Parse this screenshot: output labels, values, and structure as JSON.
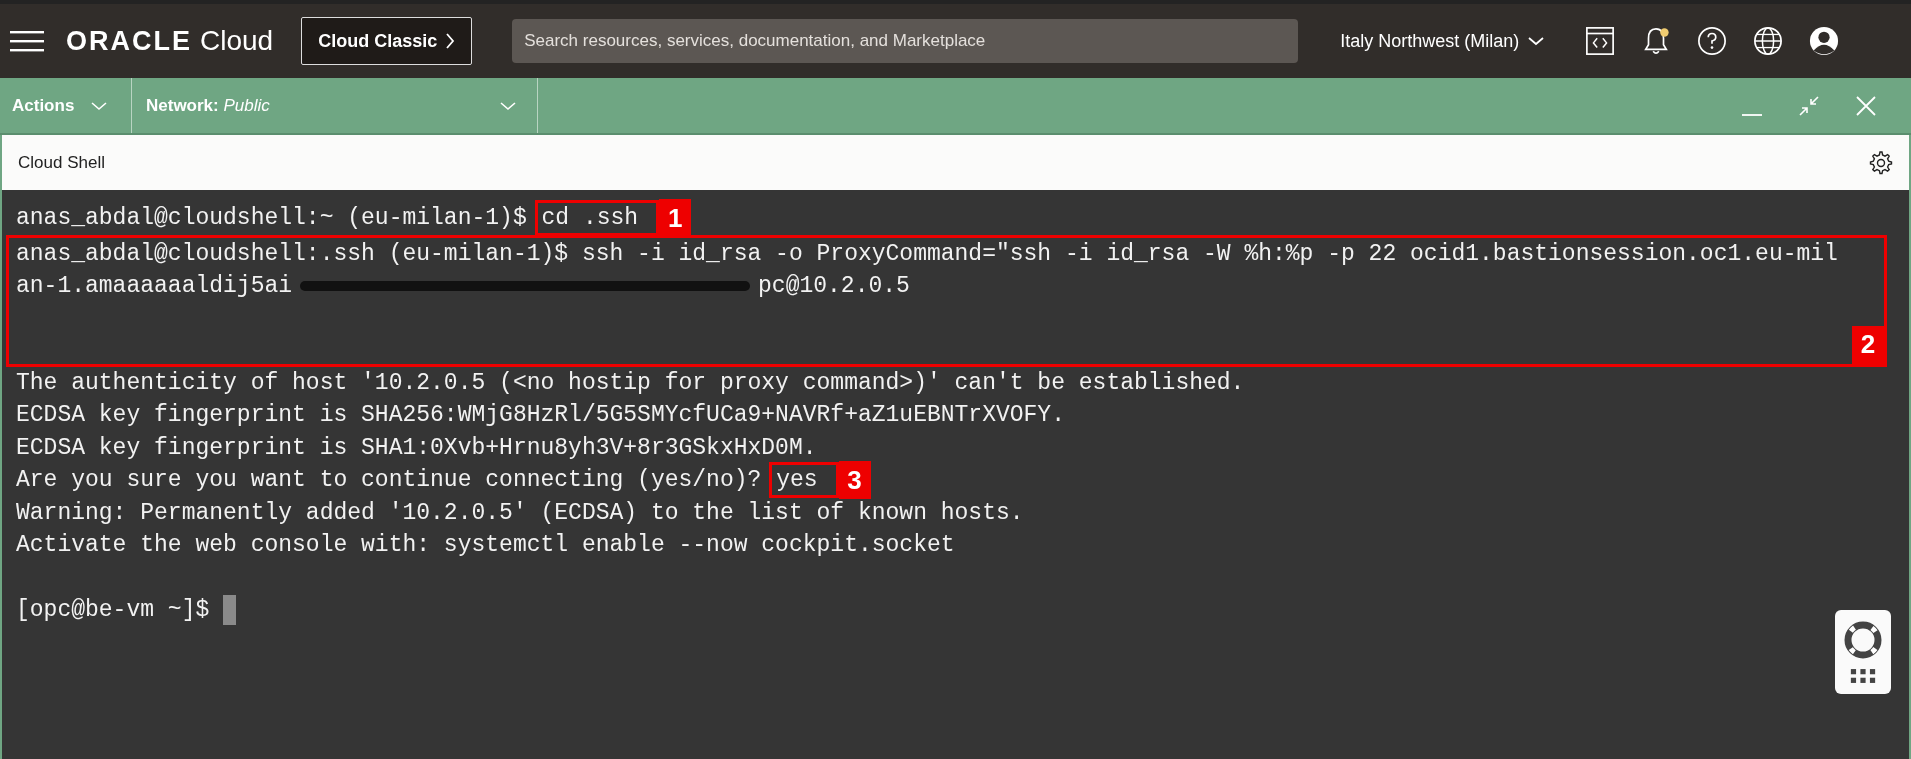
{
  "header": {
    "brand": "ORACLE",
    "product": "Cloud",
    "classic_button": "Cloud Classic",
    "search": {
      "placeholder": "Search resources, services, documentation, and Marketplace"
    },
    "region": "Italy Northwest (Milan)",
    "notification_dot": true
  },
  "shell_bar": {
    "actions": "Actions",
    "network_label": "Network:",
    "network_value": "Public"
  },
  "panel": {
    "title": "Cloud Shell"
  },
  "terminal": {
    "lines": [
      {
        "kind": "command",
        "text": "anas_abdal@cloudshell:~ (eu-milan-1)$ ",
        "command": "cd .ssh",
        "callout": "1"
      },
      {
        "kind": "group",
        "callout": "2",
        "lines": [
          {
            "text": "anas_abdal@cloudshell:.ssh (eu-milan-1)$ ssh -i id_rsa -o ProxyCommand=\"ssh -i id_rsa -W %h:%p -p 22 ocid1.bastionsession.oc1.eu-mil",
            "redacted": false
          },
          {
            "text": "an-1.amaaaaaaldij5ai",
            "redacted": true,
            "tail": "pc@10.2.0.5"
          }
        ]
      },
      {
        "kind": "plain",
        "text": "The authenticity of host '10.2.0.5 (<no hostip for proxy command>)' can't be established."
      },
      {
        "kind": "plain",
        "text": "ECDSA key fingerprint is SHA256:WMjG8HzRl/5G5SMYcfUCa9+NAVRf+aZ1uEBNTrXVOFY."
      },
      {
        "kind": "plain",
        "text": "ECDSA key fingerprint is SHA1:0Xvb+Hrnu8yh3V+8r3GSkxHxD0M."
      },
      {
        "kind": "command",
        "text": "Are you sure you want to continue connecting (yes/no)? ",
        "command": "yes",
        "callout": "3"
      },
      {
        "kind": "plain",
        "text": "Warning: Permanently added '10.2.0.5' (ECDSA) to the list of known hosts."
      },
      {
        "kind": "plain",
        "text": "Activate the web console with: systemctl enable --now cockpit.socket"
      },
      {
        "kind": "blank"
      },
      {
        "kind": "cursor",
        "text": "[opc@be-vm ~]$ "
      }
    ]
  }
}
